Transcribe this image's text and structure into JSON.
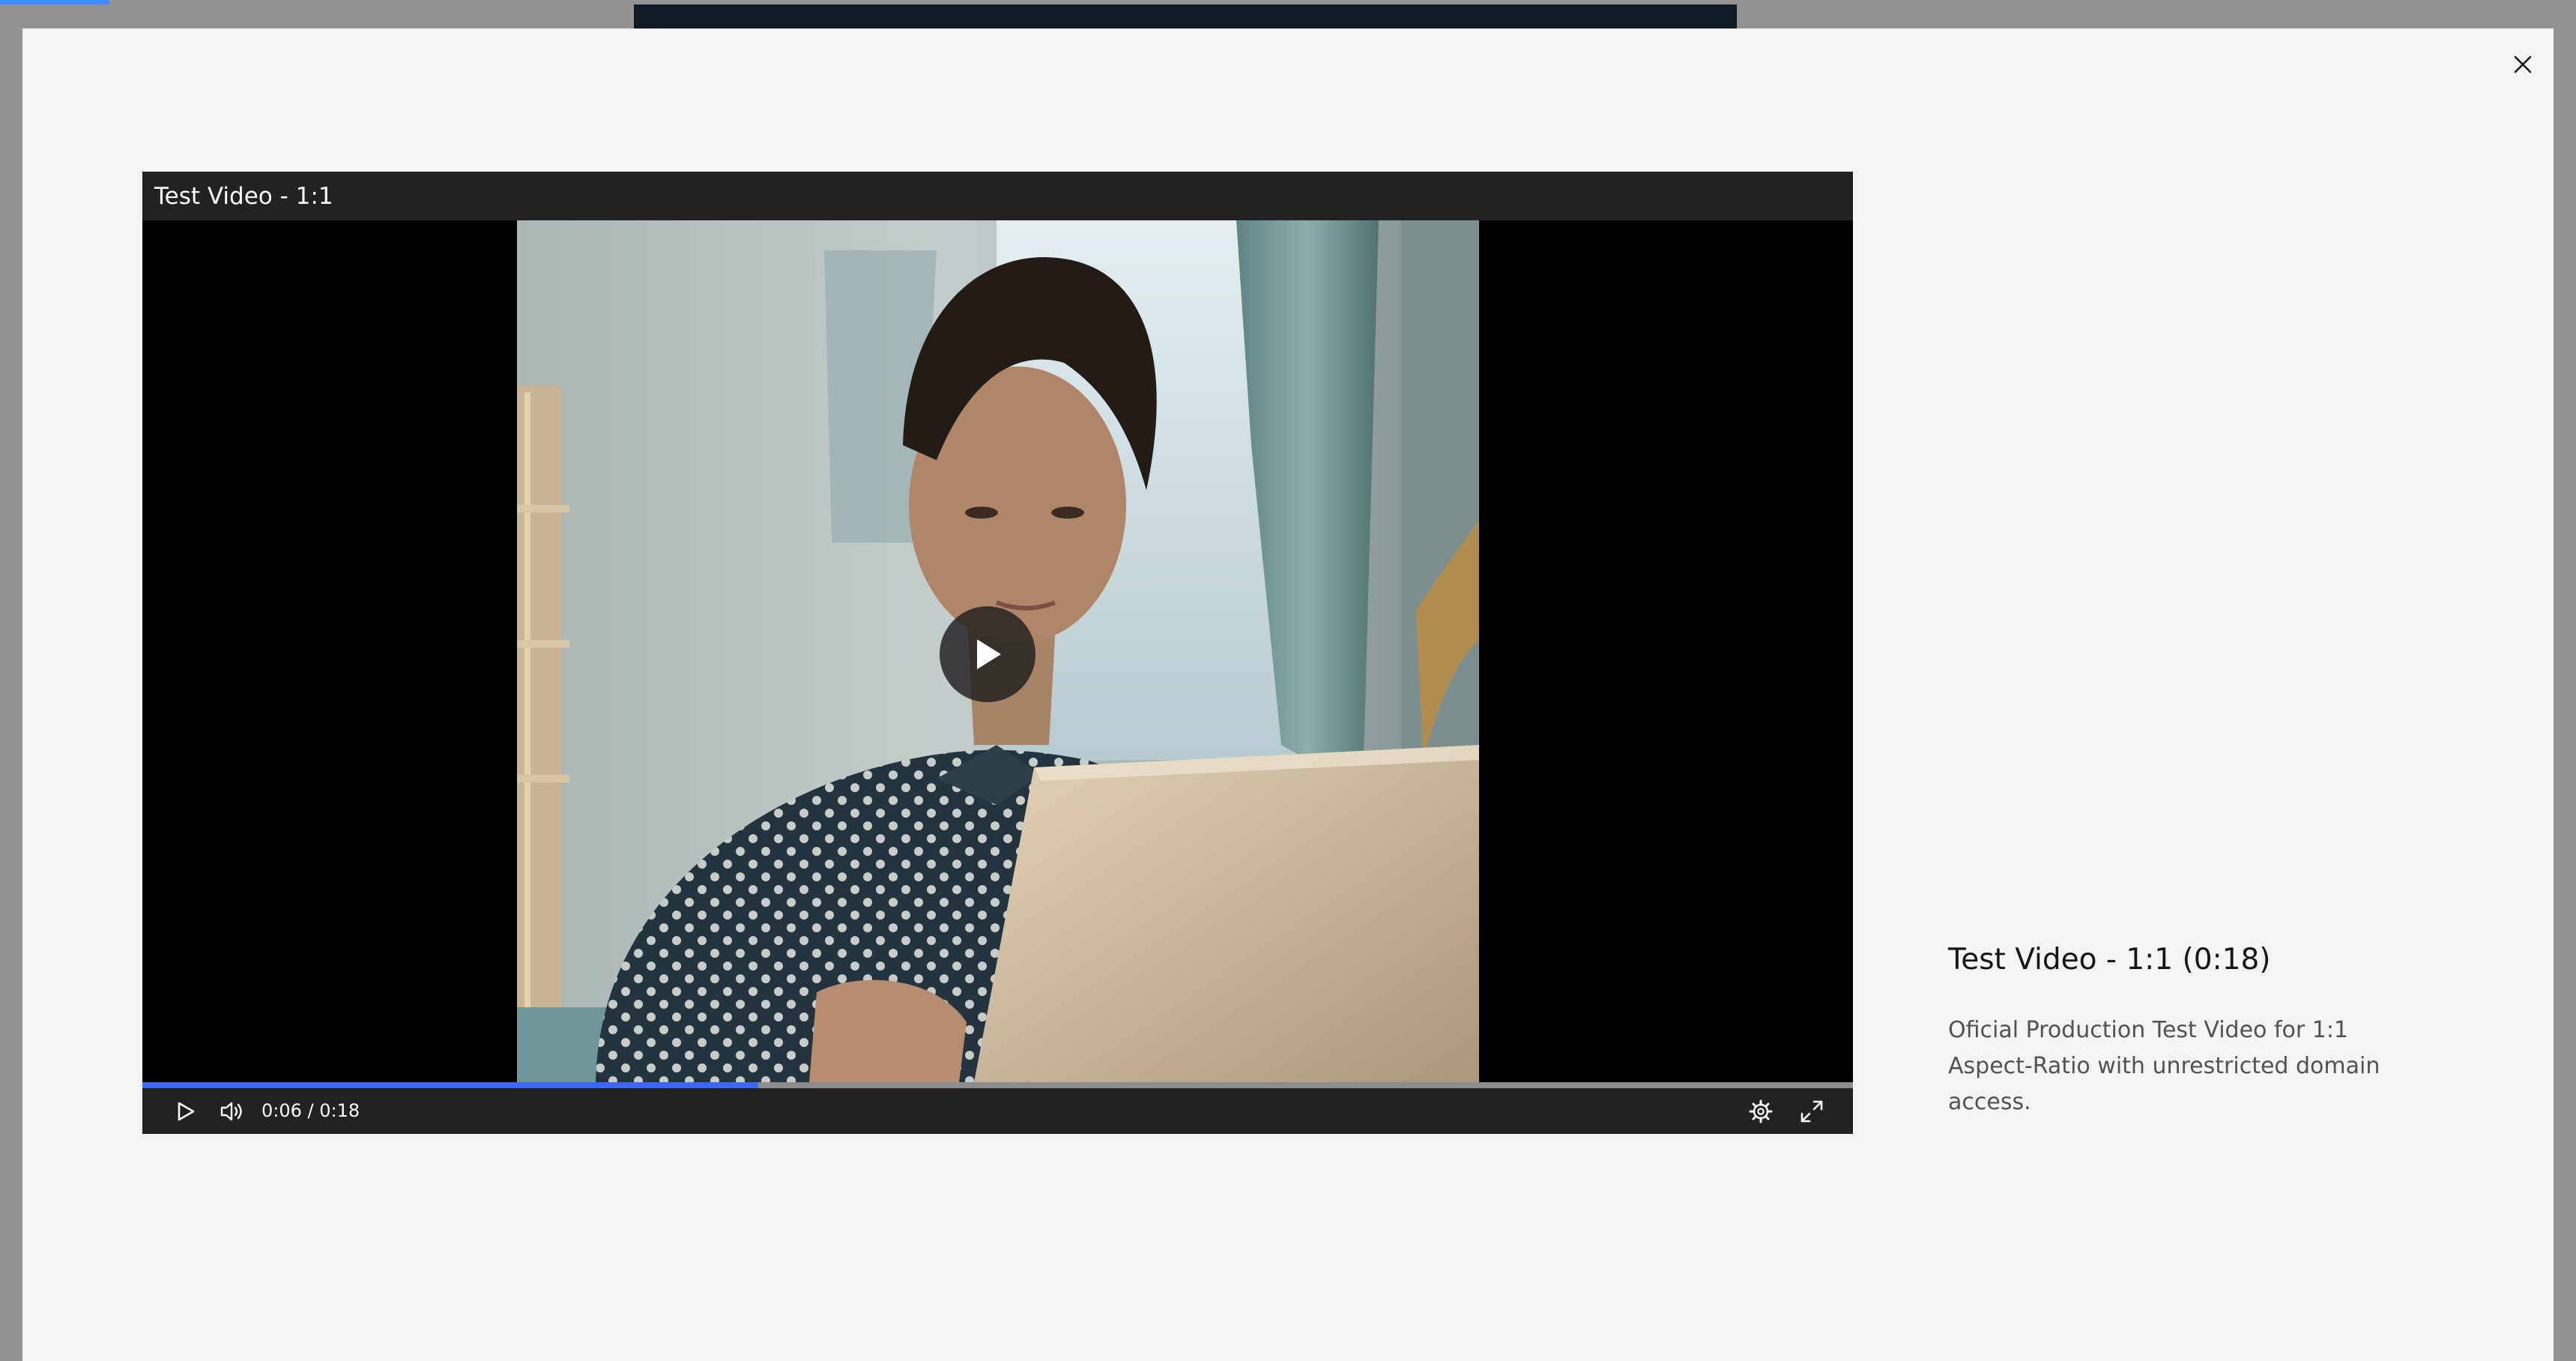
{
  "player": {
    "title": "Test Video - 1:1",
    "time_display": "0:06 / 0:18",
    "progress": 0.36
  },
  "info": {
    "title": "Test Video - 1:1 (0:18)",
    "description": "Oficial Production Test Video for 1:1 Aspect-Ratio with unrestricted domain access."
  },
  "icons": {
    "close": "close-icon",
    "play_overlay": "play-icon",
    "play": "play-icon",
    "volume": "volume-icon",
    "settings": "gear-icon",
    "fullscreen": "fullscreen-icon"
  },
  "colors": {
    "modal_background": "#f4f4f4",
    "overlay": "#939393",
    "player_bar": "#222222",
    "progress_accent": "#3d68f5",
    "page_progress_accent": "#4589ff"
  }
}
